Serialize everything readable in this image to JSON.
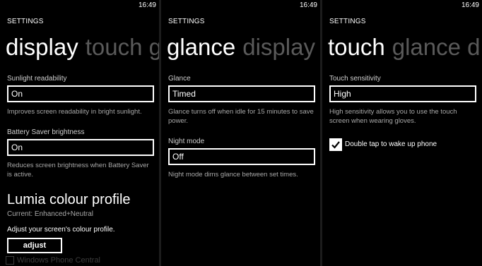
{
  "status_time": "16:49",
  "panels": [
    {
      "header": "SETTINGS",
      "pivot_active": "display",
      "pivot_next": "touch g",
      "sunlight_label": "Sunlight readability",
      "sunlight_value": "On",
      "sunlight_desc": "Improves screen readability in bright sunlight.",
      "battery_label": "Battery Saver brightness",
      "battery_value": "On",
      "battery_desc": "Reduces screen brightness when Battery Saver is active.",
      "profile_title": "Lumia colour profile",
      "profile_current": "Current: Enhanced+Neutral",
      "profile_desc": "Adjust your screen's colour profile.",
      "adjust_label": "adjust"
    },
    {
      "header": "SETTINGS",
      "pivot_active": "glance",
      "pivot_next": "display",
      "glance_label": "Glance",
      "glance_value": "Timed",
      "glance_desc": "Glance turns off when idle for 15 minutes to save power.",
      "night_label": "Night mode",
      "night_value": "Off",
      "night_desc": "Night mode dims glance between set times."
    },
    {
      "header": "SETTINGS",
      "pivot_active": "touch",
      "pivot_next": "glance d",
      "sensitivity_label": "Touch sensitivity",
      "sensitivity_value": "High",
      "sensitivity_desc": "High sensitivity allows you to use the touch screen when wearing gloves.",
      "doubletap_label": "Double tap to wake up phone",
      "doubletap_checked": true
    }
  ],
  "watermark": "Windows Phone Central"
}
